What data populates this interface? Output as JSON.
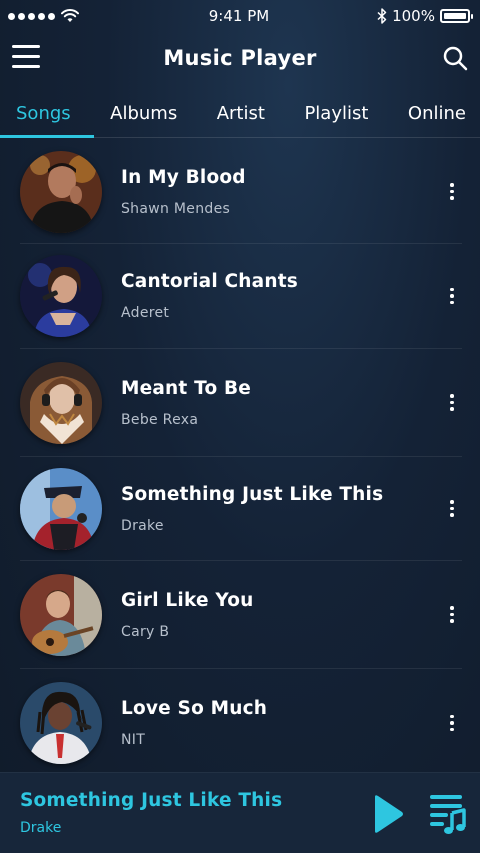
{
  "status_bar": {
    "time": "9:41 PM",
    "battery": "100%",
    "battery_level": 1.0,
    "bluetooth_icon": "bluetooth-icon",
    "wifi_icon": "wifi-icon",
    "signal_icon": "signal-dots-icon"
  },
  "header": {
    "title": "Music Player",
    "menu_icon": "hamburger-menu-icon",
    "search_icon": "search-icon"
  },
  "tabs": [
    {
      "label": "Songs",
      "active": true
    },
    {
      "label": "Albums",
      "active": false
    },
    {
      "label": "Artist",
      "active": false
    },
    {
      "label": "Playlist",
      "active": false
    },
    {
      "label": "Online",
      "active": false
    }
  ],
  "songs": [
    {
      "title": "In My Blood",
      "artist": "Shawn Mendes"
    },
    {
      "title": "Cantorial Chants",
      "artist": "Aderet"
    },
    {
      "title": "Meant To Be",
      "artist": "Bebe Rexa"
    },
    {
      "title": "Something Just Like This",
      "artist": "Drake"
    },
    {
      "title": "Girl Like You",
      "artist": "Cary B"
    },
    {
      "title": "Love So Much",
      "artist": "NIT"
    }
  ],
  "now_playing": {
    "title": "Something Just Like This",
    "artist": "Drake",
    "play_icon": "play-icon",
    "queue_icon": "music-queue-icon"
  },
  "colors": {
    "accent": "#2ec6e0",
    "background": "#142236",
    "player_bar": "#17263a",
    "secondary_text": "#b7c0cc"
  }
}
